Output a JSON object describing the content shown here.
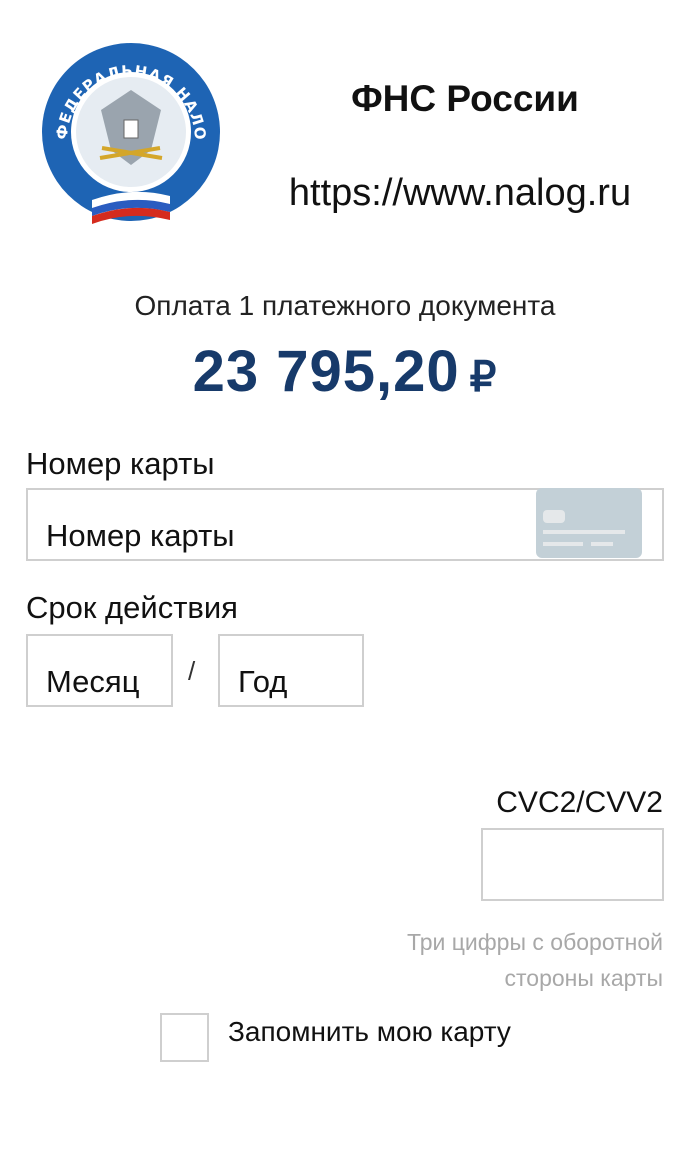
{
  "header": {
    "logo_text": "ФЕДЕРАЛЬНАЯ НАЛОГОВАЯ СЛУЖБА",
    "title": "ФНС России",
    "url": "https://www.nalog.ru"
  },
  "payment": {
    "description": "Оплата 1 платежного документа",
    "amount": "23 795,20",
    "currency": "₽"
  },
  "form": {
    "card_number_label": "Номер карты",
    "card_number_placeholder": "Номер карты",
    "expiry_label": "Срок действия",
    "month_placeholder": "Месяц",
    "separator": "/",
    "year_placeholder": "Год",
    "cvc_label": "CVC2/CVV2",
    "cvc_hint": "Три цифры с оборотной стороны карты",
    "remember_label": "Запомнить мою карту",
    "remember_checked": false
  },
  "colors": {
    "amount": "#173a6a",
    "logo_blue": "#1e64b4",
    "hint": "#a8a8a8"
  }
}
